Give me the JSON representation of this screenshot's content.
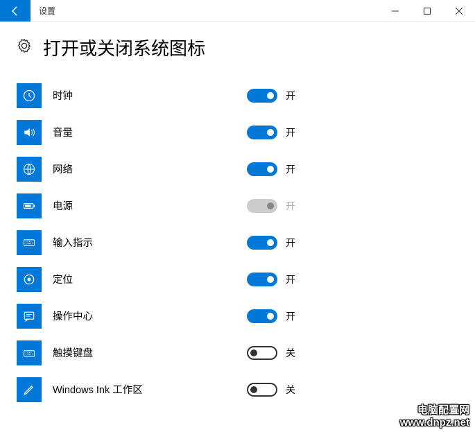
{
  "titlebar": {
    "title": "设置"
  },
  "page": {
    "title": "打开或关闭系统图标"
  },
  "options": [
    {
      "id": "clock",
      "label": "时钟",
      "state": "on",
      "state_label": "开",
      "icon": "clock"
    },
    {
      "id": "volume",
      "label": "音量",
      "state": "on",
      "state_label": "开",
      "icon": "volume"
    },
    {
      "id": "network",
      "label": "网络",
      "state": "on",
      "state_label": "开",
      "icon": "globe"
    },
    {
      "id": "power",
      "label": "电源",
      "state": "disabled",
      "state_label": "开",
      "icon": "battery"
    },
    {
      "id": "input",
      "label": "输入指示",
      "state": "on",
      "state_label": "开",
      "icon": "keyboard"
    },
    {
      "id": "location",
      "label": "定位",
      "state": "on",
      "state_label": "开",
      "icon": "target"
    },
    {
      "id": "action-center",
      "label": "操作中心",
      "state": "on",
      "state_label": "开",
      "icon": "notification"
    },
    {
      "id": "touch-keyboard",
      "label": "触摸键盘",
      "state": "off",
      "state_label": "关",
      "icon": "touch-keyboard"
    },
    {
      "id": "windows-ink",
      "label": "Windows Ink 工作区",
      "state": "off",
      "state_label": "关",
      "icon": "pen"
    }
  ],
  "watermark": {
    "line1": "电脑配置网",
    "line2": "www.dnpz.net"
  },
  "colors": {
    "accent": "#0078d7"
  }
}
